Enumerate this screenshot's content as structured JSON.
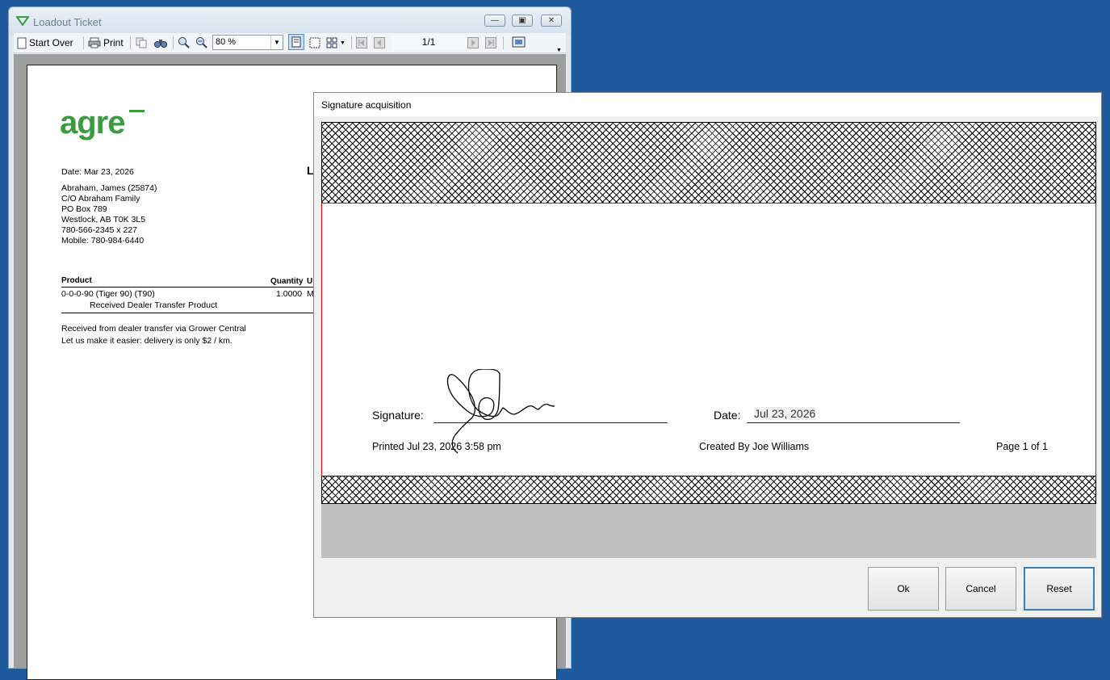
{
  "window": {
    "title": "Loadout Ticket",
    "toolbar": {
      "start_over": "Start Over",
      "print": "Print",
      "zoom": "80 %",
      "page": "1/1"
    }
  },
  "ticket": {
    "date": "Date: Mar 23, 2026",
    "heading_partial": "L",
    "address": [
      "Abraham, James (25874)",
      "C/O Abraham Family",
      "PO Box 789",
      "Westlock, AB T0K 3L5",
      "780-566-2345 x 227",
      "Mobile: 780-984-6440"
    ],
    "table": {
      "col_product": "Product",
      "col_quantity": "Quantity",
      "col_unit_partial": "U",
      "row_product": "0-0-0-90 (Tiger 90) (T90)",
      "row_quantity": "1.0000",
      "row_unit_partial": "M",
      "row_note": "Received Dealer Transfer Product"
    },
    "notes": [
      "Received from dealer transfer via Grower Central",
      "Let us make it easier: delivery is only $2 / km."
    ]
  },
  "dialog": {
    "title": "Signature acquisition",
    "signature_label": "Signature:",
    "date_label": "Date:",
    "date_value": "Jul 23, 2026",
    "printed": "Printed Jul 23, 2026 3:58 pm",
    "created_by": "Created By Joe Williams",
    "page": "Page 1 of 1",
    "buttons": {
      "ok": "Ok",
      "cancel": "Cancel",
      "reset": "Reset"
    }
  },
  "colors": {
    "desktop": "#1f5b9c",
    "logo_green": "#3b9b3e",
    "sig_border": "#e00000"
  },
  "icons": [
    "app-logo-icon",
    "minimize-icon",
    "maximize-icon",
    "close-icon",
    "page-icon",
    "printer-icon",
    "copy-icon",
    "binoculars-icon",
    "zoom-in-icon",
    "zoom-out-icon",
    "single-page-icon",
    "multi-page-icon",
    "grid-view-icon",
    "first-page-icon",
    "prev-page-icon",
    "next-page-icon",
    "last-page-icon",
    "options-icon"
  ]
}
